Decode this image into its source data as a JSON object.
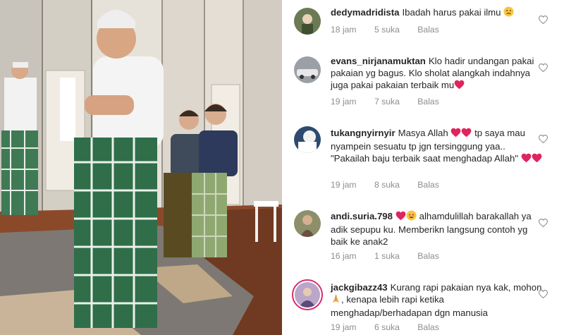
{
  "comments": [
    {
      "username": "dedymadridista",
      "text": "Ibadah harus pakai ilmu",
      "emojis_after": [
        "sad-face-emoji"
      ],
      "time": "18 jam",
      "likes": "5 suka",
      "reply": "Balas"
    },
    {
      "username": "evans_nirjanamuktan",
      "text": "Klo hadir undangan pakai pakaian yg bagus. Klo sholat alangkah indahnya juga pakai pakaian terbaik mu",
      "emojis_after": [
        "red-heart-emoji"
      ],
      "time": "19 jam",
      "likes": "7 suka",
      "reply": "Balas"
    },
    {
      "username": "tukangnyirnyir",
      "text_part1": "Masya Allah",
      "text_part2": "tp saya mau nyampein sesuatu tp jgn tersinggung yaa.. \"Pakailah baju terbaik saat menghadap Allah\"",
      "emojis": [
        "red-heart-emoji",
        "red-heart-emoji"
      ],
      "time": "19 jam",
      "likes": "8 suka",
      "reply": "Balas"
    },
    {
      "username": "andi.suria.798",
      "text": "alhamdulillah barakallah ya adik sepupu ku. Memberikn langsung contoh yg baik ke anak2",
      "emojis_before": [
        "red-heart-emoji",
        "heart-eyes-emoji"
      ],
      "time": "16 jam",
      "likes": "1 suka",
      "reply": "Balas"
    },
    {
      "username": "jackgibazz43",
      "text_part1": "Kurang rapi pakaian nya kak, mohon",
      "text_part2": ", kenapa lebih rapi ketika menghadap/berhadapan dgn manusia",
      "emojis": [
        "praying-hands-emoji"
      ],
      "time": "19 jam",
      "likes": "6 suka",
      "reply": "Balas"
    }
  ],
  "colors": {
    "username": "#262626",
    "meta": "#8e8e8e",
    "heart_red": "#e0245e",
    "story_ring": "#d72b6f"
  }
}
